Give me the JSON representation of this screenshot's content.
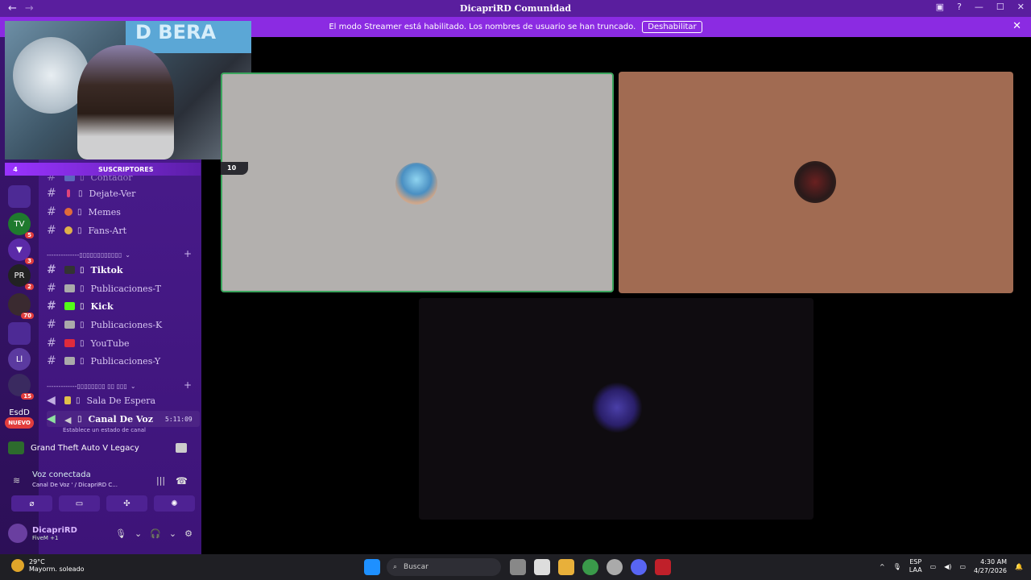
{
  "window": {
    "title": "DicapriRD Comunidad",
    "nav_back": "←",
    "nav_fwd": "→"
  },
  "banner": {
    "text": "El modo Streamer está habilitado. Los nombres de usuario se han truncado.",
    "button": "Deshabilitar",
    "close": "✕"
  },
  "overlay": {
    "subs_count": "4",
    "subs_label": "SUSCRIPTORES",
    "tile_count": "10",
    "webcam_sign": "D BERA"
  },
  "servers": [
    {
      "label": "",
      "badge": ""
    },
    {
      "label": "TV",
      "badge": "5"
    },
    {
      "label": "▼",
      "badge": "3"
    },
    {
      "label": "PR",
      "badge": "2"
    },
    {
      "label": "",
      "badge": "70"
    },
    {
      "label": "",
      "badge": ""
    },
    {
      "label": "Ll",
      "badge": ""
    },
    {
      "label": "",
      "badge": "15"
    },
    {
      "label": "EsdD",
      "badge": ""
    },
    {
      "label": "NUEVO",
      "badge": ""
    }
  ],
  "channels": {
    "partial_top": "Contador",
    "text_group_1": [
      "Dejate-Ver",
      "Memes",
      "Fans-Art"
    ],
    "category_1": "--------------▯▯▯▯▯▯▯▯▯▯▯▯",
    "text_group_2": [
      "Tiktok",
      "Publicaciones-T",
      "Kick",
      "Publicaciones-K",
      "YouTube",
      "Publicaciones-Y"
    ],
    "category_2": "-------------▯▯▯▯▯▯▯▯ ▯▯ ▯▯▯",
    "voice": [
      "Sala De Espera",
      "Canal De Voz"
    ],
    "voice_time": "5:11:09",
    "voice_status": "Establece un estado de canal"
  },
  "panel": {
    "activity": "Grand Theft Auto V Legacy",
    "voice_connected": "Voz conectada",
    "voice_channel": "Canal De Voz ' / DicapriRD C...",
    "username": "DicapriRD",
    "user_status": "FiveM +1"
  },
  "taskbar": {
    "temp": "29°C",
    "weather": "Mayorm. soleado",
    "search": "Buscar",
    "lang_1": "ESP",
    "lang_2": "LAA",
    "time": "4:30 AM",
    "date": "4/27/2026"
  },
  "colors": {
    "accent": "#8b2be2",
    "tile_grey": "#b3b0ae",
    "tile_brown": "#a16b52",
    "tile_dark": "#0f0c10"
  }
}
